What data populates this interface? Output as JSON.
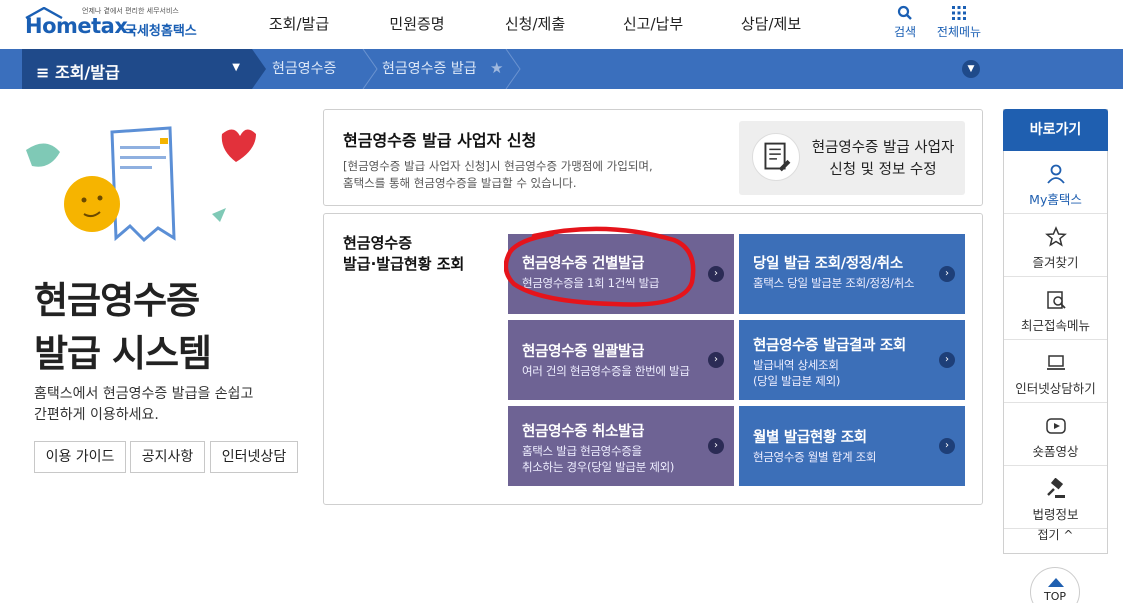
{
  "header": {
    "logo_tagline": "언제나 곁에서 편리한 세무서비스",
    "logo_brand": "Hometax.",
    "logo_sub": "국세청홈택스",
    "nav": [
      "조회/발급",
      "민원증명",
      "신청/제출",
      "신고/납부",
      "상담/제보"
    ],
    "search_label": "검색",
    "allmenu_label": "전체메뉴"
  },
  "subbar": {
    "menu_label": "조회/발급",
    "breadcrumb": [
      "현금영수증",
      "현금영수증 발급"
    ]
  },
  "hero": {
    "title_line1": "현금영수증",
    "title_line2": "발급 시스템",
    "desc_line1": "홈택스에서 현금영수증 발급을 손쉽고",
    "desc_line2": "간편하게 이용하세요.",
    "buttons": [
      "이용 가이드",
      "공지사항",
      "인터넷상담"
    ]
  },
  "apply_panel": {
    "title": "현금영수증 발급 사업자 신청",
    "desc_line1": "[현금영수증 발급 사업자 신청]시 현금영수증 가맹점에 가입되며,",
    "desc_line2": "홈택스를 통해 현금영수증을 발급할 수 있습니다.",
    "action_line1": "현금영수증 발급 사업자",
    "action_line2": "신청 및 정보 수정"
  },
  "issue_panel": {
    "title_line1": "현금영수증",
    "title_line2": "발급·발급현황 조회",
    "tiles": [
      {
        "title": "현금영수증 건별발급",
        "desc1": "현금영수증을 1회 1건씩 발급",
        "desc2": ""
      },
      {
        "title": "당일 발급 조회/정정/취소",
        "desc1": "홈택스 당일 발급분 조회/정정/취소",
        "desc2": ""
      },
      {
        "title": "현금영수증 일괄발급",
        "desc1": "여러 건의 현금영수증을 한번에 발급",
        "desc2": ""
      },
      {
        "title": "현금영수증 발급결과 조회",
        "desc1": "발급내역 상세조회",
        "desc2": "(당일 발급분 제외)"
      },
      {
        "title": "현금영수증 취소발급",
        "desc1": "홈택스 발급 현금영수증을",
        "desc2": "취소하는 경우(당일 발급분 제외)"
      },
      {
        "title": "월별 발급현황 조회",
        "desc1": "현금영수증 월별 합계 조회",
        "desc2": ""
      }
    ]
  },
  "quick": {
    "header": "바로가기",
    "items": [
      "My홈택스",
      "즐겨찾기",
      "최근접속메뉴",
      "인터넷상담하기",
      "숏폼영상",
      "법령정보"
    ],
    "fold_label": "접기 ^",
    "top_label": "TOP"
  },
  "colors": {
    "brand_blue": "#1a5fb4",
    "subbar_blue": "#3a6fbd",
    "tile_purple": "#6e6394",
    "tile_blue": "#3c6fb8",
    "annotation_red": "#e5141b"
  }
}
